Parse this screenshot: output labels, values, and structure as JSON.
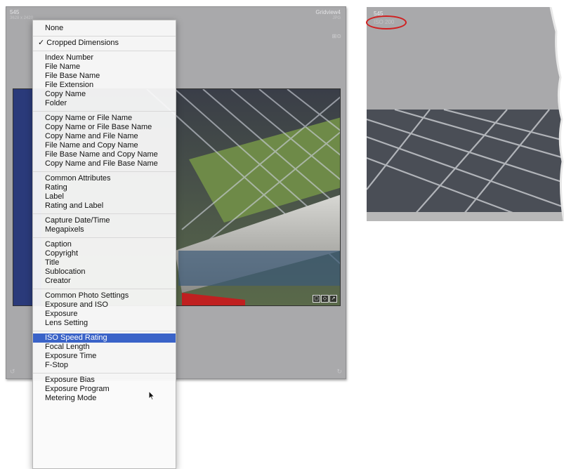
{
  "grid_cell": {
    "index": "545",
    "dimensions": "3628 x 2420",
    "filename": "Gridview4",
    "extension": "JPG",
    "badges": [
      "▢",
      "◇",
      "↗"
    ]
  },
  "zoom": {
    "index": "545",
    "iso": "ISO 200"
  },
  "menu": {
    "groups": [
      [
        {
          "label": "None"
        }
      ],
      [
        {
          "label": "Cropped Dimensions",
          "checked": true,
          "check": "✓"
        }
      ],
      [
        {
          "label": "Index Number"
        },
        {
          "label": "File Name"
        },
        {
          "label": "File Base Name"
        },
        {
          "label": "File Extension"
        },
        {
          "label": "Copy Name"
        },
        {
          "label": "Folder"
        }
      ],
      [
        {
          "label": "Copy Name or File Name"
        },
        {
          "label": "Copy Name or File Base Name"
        },
        {
          "label": "Copy Name and File Name"
        },
        {
          "label": "File Name and Copy Name"
        },
        {
          "label": "File Base Name and Copy Name"
        },
        {
          "label": "Copy Name and File Base Name"
        }
      ],
      [
        {
          "label": "Common Attributes"
        },
        {
          "label": "Rating"
        },
        {
          "label": "Label"
        },
        {
          "label": "Rating and Label"
        }
      ],
      [
        {
          "label": "Capture Date/Time"
        },
        {
          "label": "Megapixels"
        }
      ],
      [
        {
          "label": "Caption"
        },
        {
          "label": "Copyright"
        },
        {
          "label": "Title"
        },
        {
          "label": "Sublocation"
        },
        {
          "label": "Creator"
        }
      ],
      [
        {
          "label": "Common Photo Settings"
        },
        {
          "label": "Exposure and ISO"
        },
        {
          "label": "Exposure"
        },
        {
          "label": "Lens Setting"
        }
      ],
      [
        {
          "label": "ISO Speed Rating",
          "highlighted": true
        },
        {
          "label": "Focal Length"
        },
        {
          "label": "Exposure Time"
        },
        {
          "label": "F-Stop"
        }
      ],
      [
        {
          "label": "Exposure Bias"
        },
        {
          "label": "Exposure Program"
        },
        {
          "label": "Metering Mode"
        }
      ]
    ]
  },
  "colors": {
    "cell_bg": "#a9a9ab",
    "highlight": "#3a63c8",
    "annotation_circle": "#d02020"
  }
}
